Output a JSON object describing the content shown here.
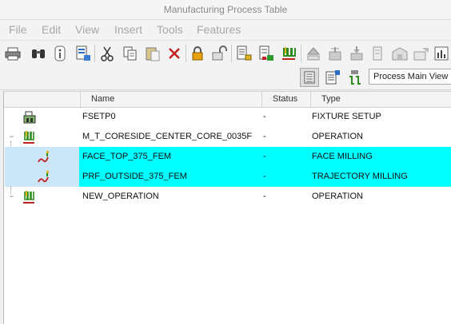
{
  "window": {
    "title": "Manufacturing Process Table"
  },
  "menu": [
    "File",
    "Edit",
    "View",
    "Insert",
    "Tools",
    "Features"
  ],
  "toolbar_icons": [
    "print-icon",
    "find-icon",
    "info-icon",
    "page-setup-icon",
    "cut-icon",
    "copy-icon",
    "paste-icon",
    "delete-icon",
    "lock-icon",
    "unlock-icon",
    "edit-params-icon",
    "tool-manager-icon",
    "operation-icon",
    "move-up-icon",
    "move-down-icon",
    "insert-icon",
    "column-icon",
    "fixture-icon",
    "chart-icon",
    "more-icon"
  ],
  "view": {
    "selected": "Process Main View",
    "buttons": [
      "list-view-icon",
      "detail-view-icon",
      "tree-view-icon"
    ]
  },
  "table": {
    "columns": {
      "name": "Name",
      "status": "Status",
      "type": "Type"
    },
    "rows": [
      {
        "name": "FSETP0",
        "status": "-",
        "type": "FIXTURE SETUP",
        "icon": "fixture-setup-icon",
        "selected": false,
        "expand": ""
      },
      {
        "name": "M_T_CORESIDE_CENTER_CORE_0035F",
        "status": "-",
        "type": "OPERATION",
        "icon": "operation-icon",
        "selected": false,
        "expand": "−"
      },
      {
        "name": "FACE_TOP_375_FEM",
        "status": "-",
        "type": "FACE MILLING",
        "icon": "milling-step-icon",
        "selected": true,
        "expand": ""
      },
      {
        "name": "PRF_OUTSIDE_375_FEM",
        "status": "-",
        "type": "TRAJECTORY MILLING",
        "icon": "milling-step-icon",
        "selected": true,
        "expand": ""
      },
      {
        "name": "NEW_OPERATION",
        "status": "-",
        "type": "OPERATION",
        "icon": "operation-icon",
        "selected": false,
        "expand": "−"
      }
    ]
  }
}
